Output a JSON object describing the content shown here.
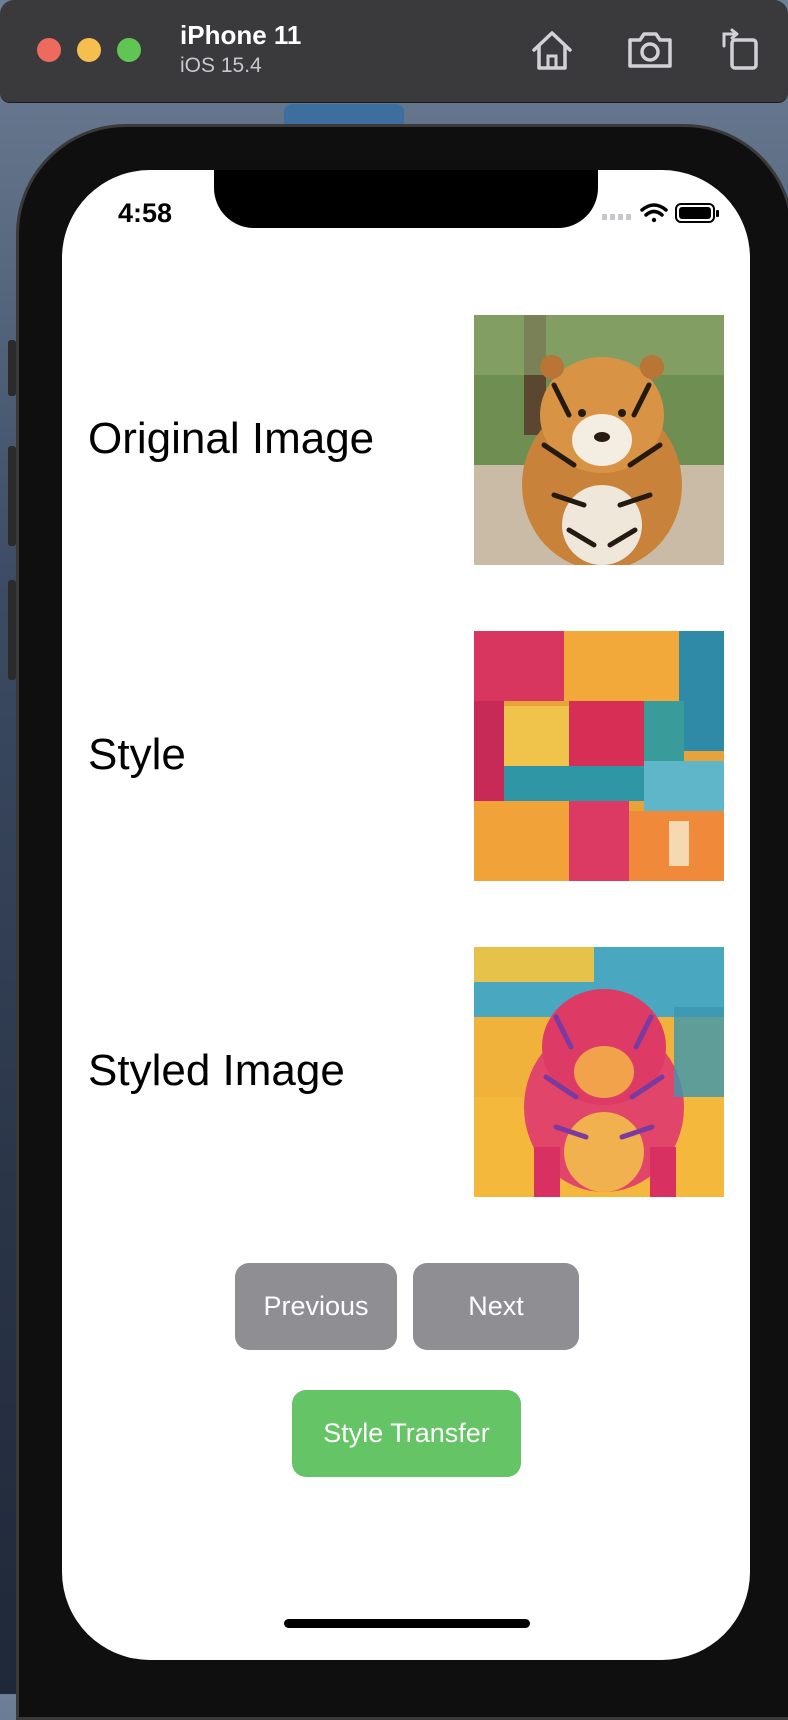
{
  "simulator": {
    "device_name": "iPhone 11",
    "os_version": "iOS 15.4",
    "toolbar_icons": [
      "home-icon",
      "screenshot-camera-icon",
      "rotate-icon"
    ]
  },
  "status_bar": {
    "time": "4:58",
    "icons": [
      "cellular-icon",
      "wifi-icon",
      "battery-icon"
    ]
  },
  "rows": [
    {
      "label": "Original Image",
      "image": "tiger-photo"
    },
    {
      "label": "Style",
      "image": "colorful-abstract-painting"
    },
    {
      "label": "Styled Image",
      "image": "stylized-tiger"
    }
  ],
  "buttons": {
    "previous": "Previous",
    "next": "Next",
    "style_transfer": "Style Transfer"
  },
  "colors": {
    "gray_button": "#8e8e93",
    "green_button": "#65c466"
  }
}
